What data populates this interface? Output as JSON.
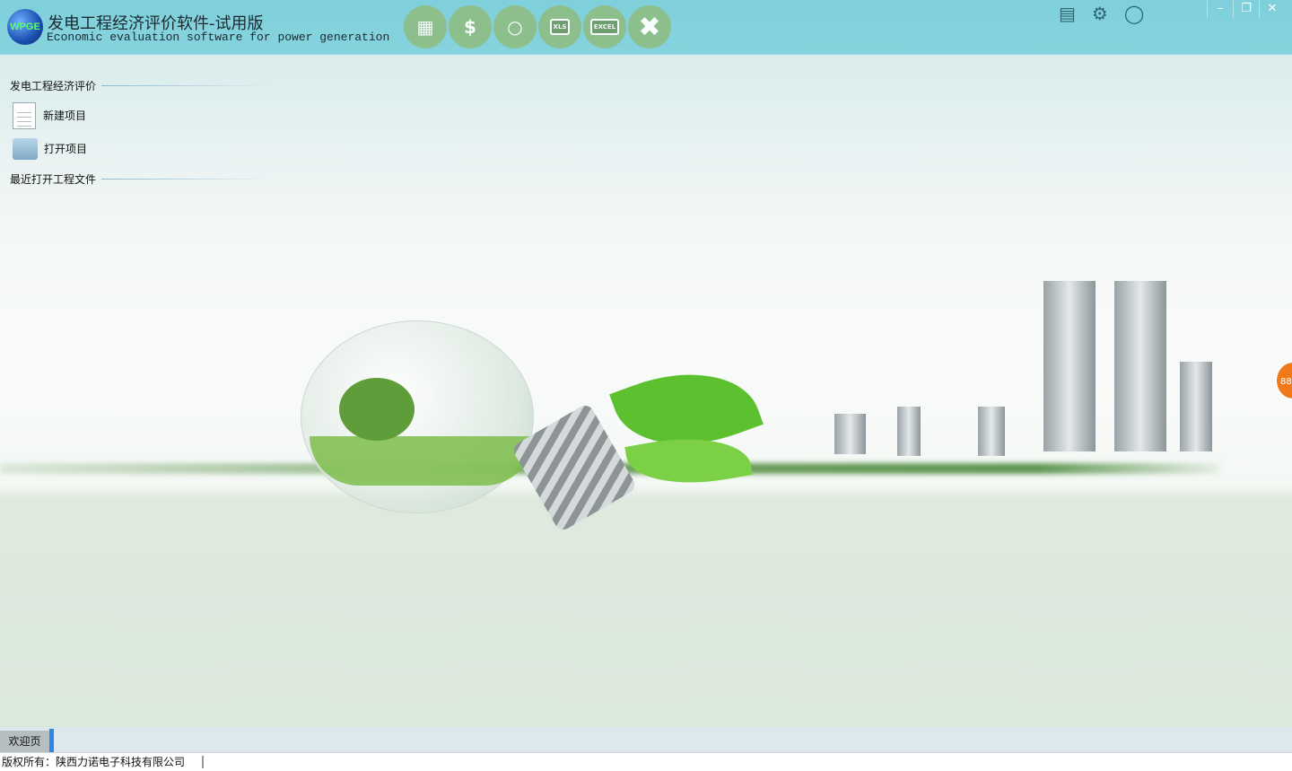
{
  "app": {
    "logo_text": "WPGE",
    "title": "发电工程经济评价软件-试用版",
    "subtitle": "Economic evaluation software for power generation"
  },
  "toolbar": [
    {
      "icon": "calculator-icon"
    },
    {
      "icon": "money-cycle-icon"
    },
    {
      "icon": "search-icon"
    },
    {
      "icon": "xls-download-icon",
      "label": "XLS"
    },
    {
      "icon": "excel-icon",
      "label": "EXCEL"
    },
    {
      "icon": "close-x-icon"
    }
  ],
  "header_icons": [
    "document-icon",
    "gear-icon",
    "chat-icon"
  ],
  "sidebar": {
    "section1": "发电工程经济评价",
    "items": [
      {
        "label": "新建项目",
        "icon": "new-document-icon"
      },
      {
        "label": "打开项目",
        "icon": "folder-icon"
      }
    ],
    "section2": "最近打开工程文件"
  },
  "floating_badge": "88",
  "tabs": [
    {
      "label": "欢迎页",
      "active": true
    }
  ],
  "status": {
    "copyright": "版权所有：陕西力诺电子科技有限公司"
  },
  "colors": {
    "titlebar": "#83d2dc",
    "tab_accent": "#2a86e8",
    "badge": "#f07a1a"
  }
}
